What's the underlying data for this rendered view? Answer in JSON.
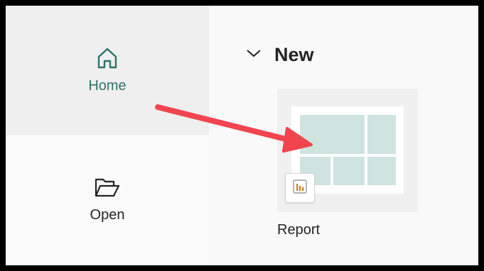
{
  "sidebar": {
    "items": [
      {
        "label": "Home",
        "icon": "home-icon",
        "selected": true
      },
      {
        "label": "Open",
        "icon": "folder-open-icon",
        "selected": false
      }
    ]
  },
  "main": {
    "section_title": "New",
    "section_expanded": true,
    "cards": [
      {
        "label": "Report",
        "icon": "bar-chart-icon"
      }
    ]
  },
  "colors": {
    "selected_accent": "#2f7563",
    "selected_background": "#efefef",
    "tile_fill": "#cfe3df",
    "arrow": "#f0454e",
    "badge_bars": "#c7872c"
  }
}
